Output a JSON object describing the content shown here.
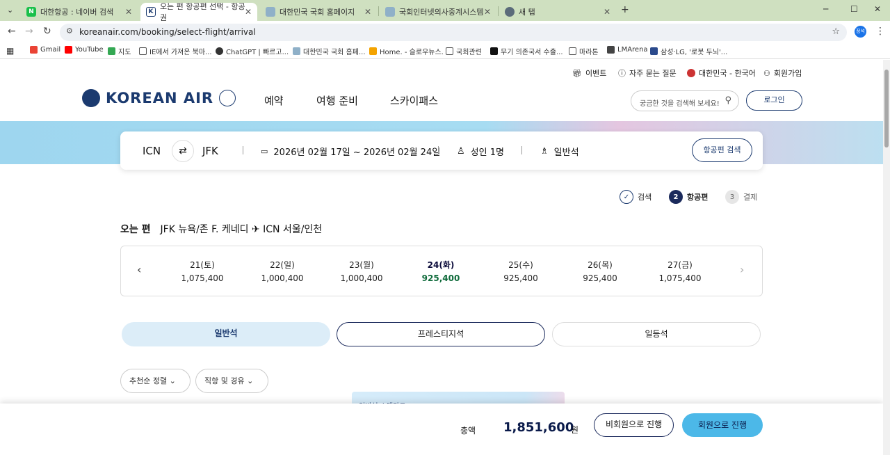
{
  "browser": {
    "tabs": [
      {
        "title": "대한항공 : 네이버 검색"
      },
      {
        "title": "오는 편 항공편 선택 - 항공권"
      },
      {
        "title": "대한민국 국회 홈페이지"
      },
      {
        "title": "국회인터넷의사중계시스템"
      },
      {
        "title": "새 탭"
      }
    ],
    "new_tab": "+",
    "minimize": "─",
    "maximize": "☐",
    "close": "✕",
    "url": "koreanair.com/booking/select-flight/arrival",
    "profile": "정석",
    "bookmarks": [
      "Gmail",
      "YouTube",
      "지도",
      "IE에서 가져온 북마...",
      "ChatGPT | 빠르고...",
      "대한민국 국회 홈페...",
      "Home. - 슬로우뉴스.",
      "국회관련",
      "무기 의존국서 수출...",
      "마라톤",
      "LMArena",
      "삼성·LG, '로봇 두뇌'..."
    ]
  },
  "util": {
    "event": "이벤트",
    "faq": "자주 묻는 질문",
    "region": "대한민국 - 한국어",
    "signup": "회원가입"
  },
  "logo": "KOREAN AIR",
  "gnb": [
    "예약",
    "여행 준비",
    "스카이패스"
  ],
  "search_placeholder": "궁금한 것을 검색해 보세요!",
  "login": "로그인",
  "summary": {
    "from": "ICN",
    "to": "JFK",
    "dates": "2026년 02월 17일 ~ 2026년 02월 24일",
    "pax": "성인 1명",
    "cabin": "일반석",
    "button": "항공편 검색"
  },
  "steps": [
    {
      "num": "✓",
      "label": "검색"
    },
    {
      "num": "2",
      "label": "항공편"
    },
    {
      "num": "3",
      "label": "결제"
    }
  ],
  "route": {
    "label": "오는 편",
    "text": "JFK 뉴욕/존 F. 케네디 ✈ ICN 서울/인천"
  },
  "dates": [
    {
      "d": "21(토)",
      "p": "1,075,400"
    },
    {
      "d": "22(일)",
      "p": "1,000,400"
    },
    {
      "d": "23(월)",
      "p": "1,000,400"
    },
    {
      "d": "24(화)",
      "p": "925,400"
    },
    {
      "d": "25(수)",
      "p": "925,400"
    },
    {
      "d": "26(목)",
      "p": "925,400"
    },
    {
      "d": "27(금)",
      "p": "1,075,400"
    }
  ],
  "cabins": [
    "일반석",
    "프레스티지석",
    "일등석"
  ],
  "filters": [
    "추천순 정렬",
    "직항 및 경유"
  ],
  "promo": "일반석 스탠다드",
  "footer": {
    "total_label": "총액",
    "total": "1,851,600",
    "unit": "원",
    "guest": "비회원으로 진행",
    "member": "회원으로 진행"
  }
}
